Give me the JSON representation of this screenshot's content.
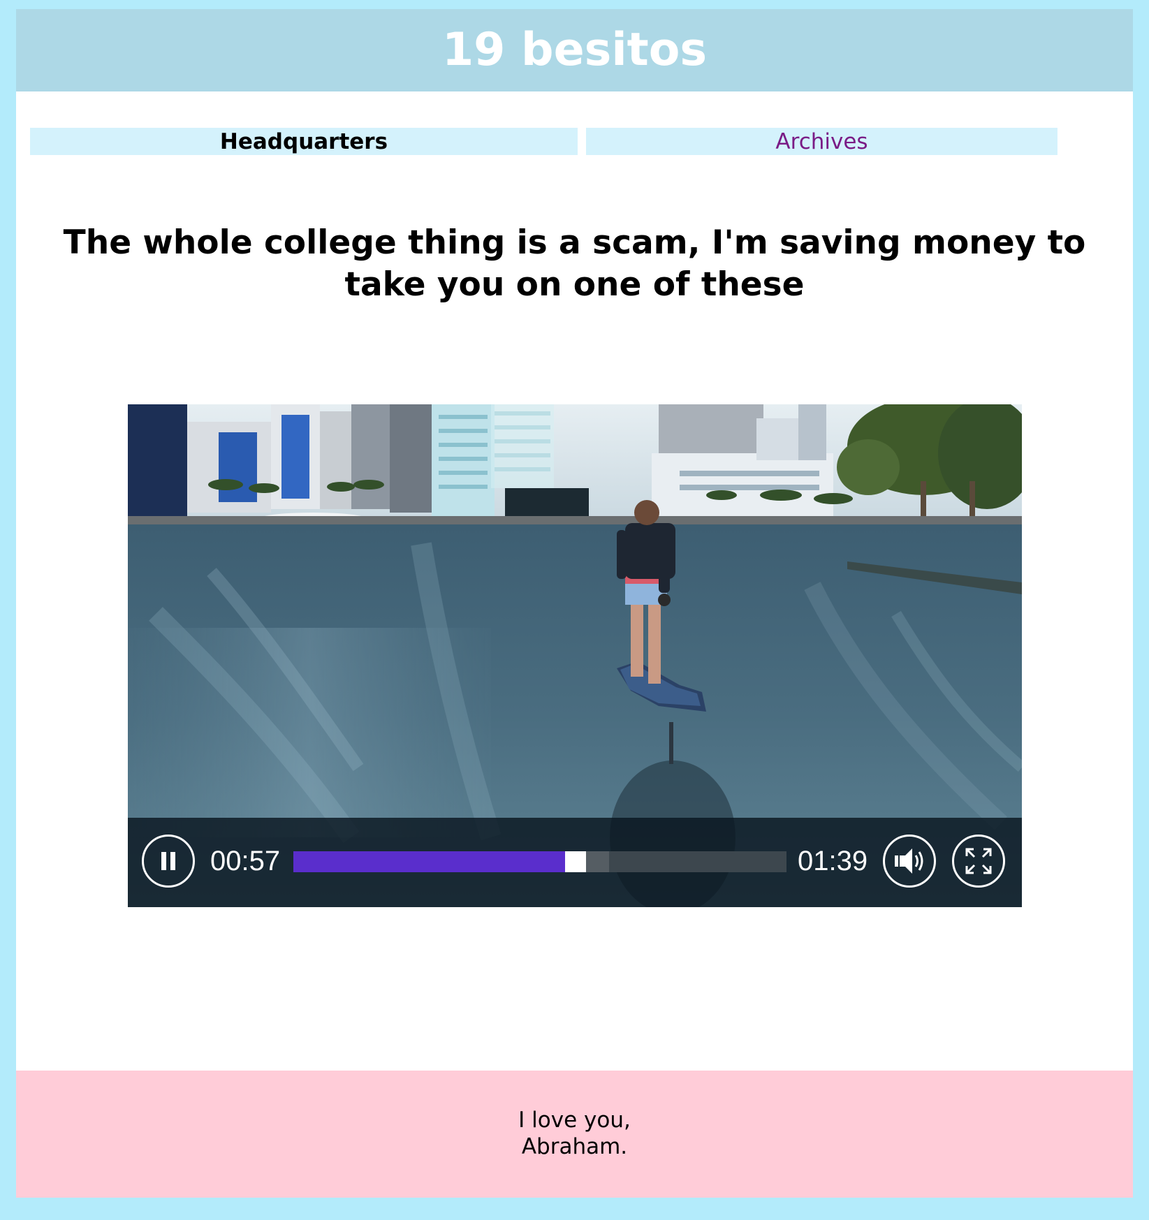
{
  "header": {
    "title": "19 besitos"
  },
  "nav": {
    "items": [
      {
        "label": "Headquarters"
      },
      {
        "label": "Archives"
      }
    ]
  },
  "post": {
    "headline": "The whole college thing is a scam, I'm saving money to take you on one of these"
  },
  "video": {
    "state": "playing",
    "current_time": "00:57",
    "duration": "01:39",
    "progress_fraction": 0.576,
    "buffered_fraction": 0.64,
    "colors": {
      "progress": "#5a2ecc",
      "controls_bg": "#0a1620"
    },
    "icons": {
      "play": "pause-icon",
      "volume": "volume-icon",
      "fullscreen": "fullscreen-icon"
    }
  },
  "footer": {
    "line1": "I love you,",
    "line2": "Abraham."
  },
  "colors": {
    "page_bg": "#b3ebfb",
    "header_bg": "#add8e6",
    "nav_bg": "#d4f2fc",
    "visited_link": "#7a1c86",
    "footer_bg": "#ffccd8"
  }
}
